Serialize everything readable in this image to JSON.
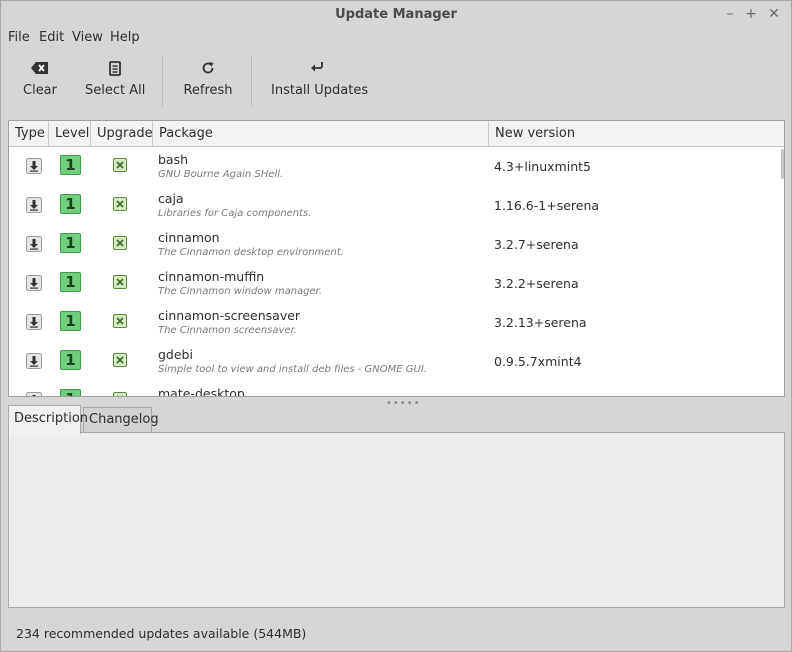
{
  "window": {
    "title": "Update Manager",
    "controls": [
      "minimize",
      "maximize",
      "close"
    ]
  },
  "menu": [
    "File",
    "Edit",
    "View",
    "Help"
  ],
  "toolbar": {
    "clear_label": "Clear",
    "select_all_label": "Select All",
    "refresh_label": "Refresh",
    "install_label": "Install Updates"
  },
  "columns": {
    "type": "Type",
    "level": "Level",
    "upgrade": "Upgrade",
    "package": "Package",
    "new_version": "New version"
  },
  "updates": [
    {
      "level": "1",
      "name": "bash",
      "desc": "GNU Bourne Again SHell.",
      "version": "4.3+linuxmint5",
      "checked": true
    },
    {
      "level": "1",
      "name": "caja",
      "desc": "Libraries for Caja components.",
      "version": "1.16.6-1+serena",
      "checked": true
    },
    {
      "level": "1",
      "name": "cinnamon",
      "desc": "The Cinnamon desktop environment.",
      "version": "3.2.7+serena",
      "checked": true
    },
    {
      "level": "1",
      "name": "cinnamon-muffin",
      "desc": "The Cinnamon window manager.",
      "version": "3.2.2+serena",
      "checked": true
    },
    {
      "level": "1",
      "name": "cinnamon-screensaver",
      "desc": "The Cinnamon screensaver.",
      "version": "3.2.13+serena",
      "checked": true
    },
    {
      "level": "1",
      "name": "gdebi",
      "desc": "Simple tool to view and install deb files - GNOME GUI.",
      "version": "0.9.5.7xmint4",
      "checked": true
    },
    {
      "level": "1",
      "name": "mate-desktop",
      "desc": "",
      "version": "",
      "checked": true
    }
  ],
  "tabs": {
    "description": "Description",
    "changelog": "Changelog",
    "active": "Description"
  },
  "status": "234 recommended updates available (544MB)",
  "colors": {
    "level_badge": "#6fcf7e",
    "checkbox": "#d6ebc6",
    "window_bg": "#d6d6d6"
  }
}
